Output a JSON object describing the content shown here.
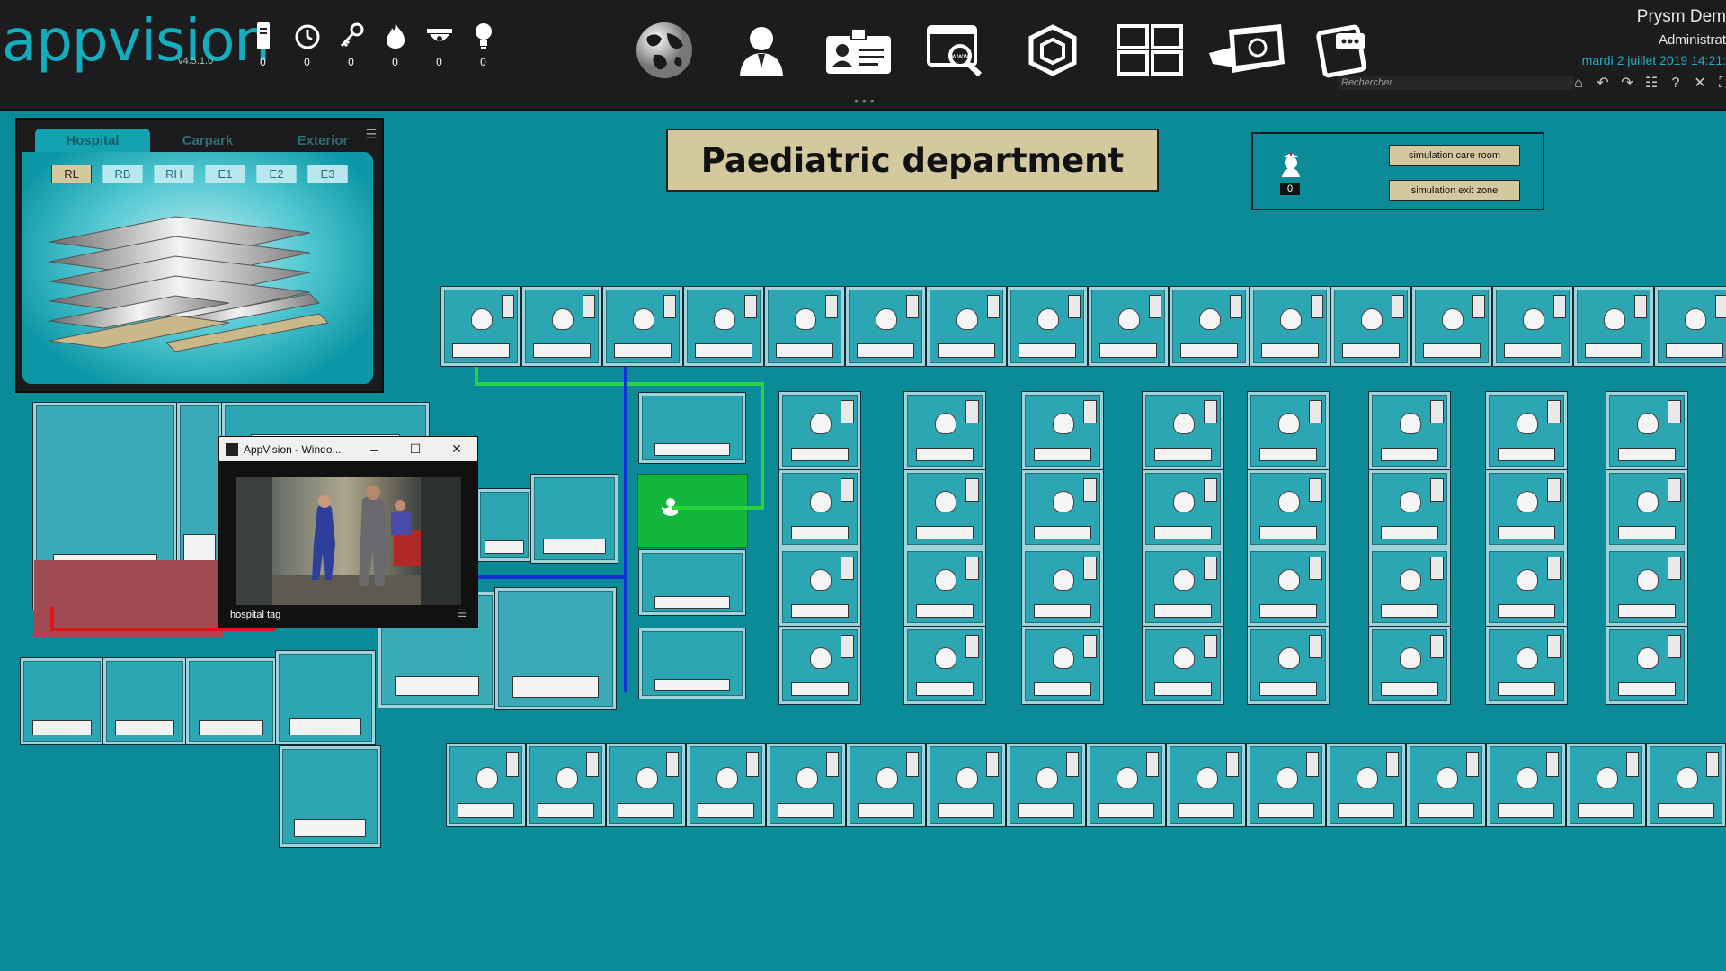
{
  "app": {
    "logo": "appvision",
    "version": "v4.5.1.0"
  },
  "counters": [
    {
      "icon": "server-icon",
      "value": "0"
    },
    {
      "icon": "timer-icon",
      "value": "0"
    },
    {
      "icon": "key-icon",
      "value": "0"
    },
    {
      "icon": "fire-icon",
      "value": "0"
    },
    {
      "icon": "dome-camera-icon",
      "value": "0"
    },
    {
      "icon": "lightbulb-icon",
      "value": "0"
    }
  ],
  "nav_icons": [
    "globe-icon",
    "user-icon",
    "badge-icon",
    "web-search-icon",
    "cube-icon",
    "monitors-icon",
    "map-icon",
    "tablet-icon"
  ],
  "user": {
    "name": "Prysm Dem",
    "role": "Administrat",
    "datetime": "mardi 2 juillet 2019 14:21:"
  },
  "search": {
    "placeholder": "Rechercher"
  },
  "toolbar_icons": [
    "home-icon",
    "undo-icon",
    "redo-icon",
    "settings-list-icon",
    "help-icon",
    "tools-icon",
    "fullscreen-icon"
  ],
  "page": {
    "title": "Paediatric department"
  },
  "simulation": {
    "count": "0",
    "care_room_label": "simulation care room",
    "exit_zone_label": "simulation exit zone"
  },
  "level_panel": {
    "tabs": [
      "Hospital",
      "Carpark",
      "Exterior"
    ],
    "active_tab": "Hospital",
    "levels": [
      "RL",
      "RB",
      "RH",
      "E1",
      "E2",
      "E3"
    ],
    "active_level": "RL"
  },
  "camera_window": {
    "title": "AppVision - Windo...",
    "minimize": "–",
    "maximize": "☐",
    "close": "✕",
    "label": "hospital tag",
    "menu": "☰"
  },
  "colors": {
    "background": "#0b8a98",
    "topbar": "#1c1c1e",
    "accent": "#13aebe",
    "title_box": "#d3c89e",
    "alarm_room": "#12b63c",
    "path_green": "#27d43c",
    "path_blue": "#1432d2",
    "path_red": "#e0141e"
  }
}
